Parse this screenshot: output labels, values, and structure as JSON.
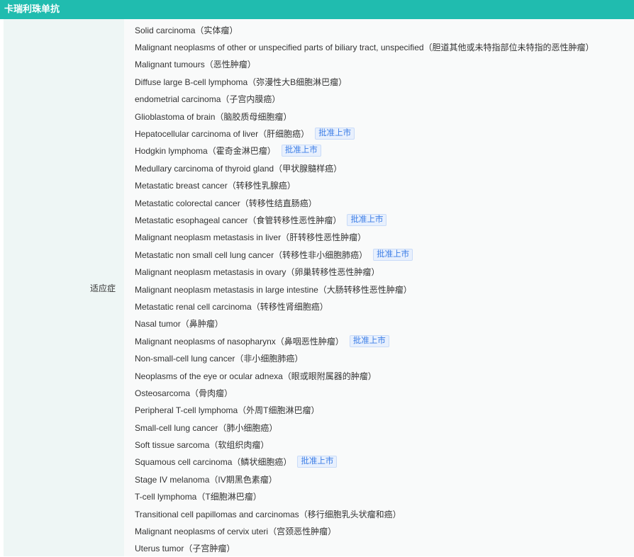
{
  "header": {
    "title": "卡瑞利珠单抗"
  },
  "row": {
    "label": "适应症"
  },
  "badge_label": "批准上市",
  "items": [
    {
      "text": "Solid carcinoma（实体瘤）",
      "approved": false
    },
    {
      "text": "Malignant neoplasms of other or unspecified parts of biliary tract, unspecified（胆道其他或未特指部位未特指的恶性肿瘤）",
      "approved": false
    },
    {
      "text": "Malignant tumours（恶性肿瘤）",
      "approved": false
    },
    {
      "text": "Diffuse large B-cell lymphoma（弥漫性大B细胞淋巴瘤）",
      "approved": false
    },
    {
      "text": "endometrial carcinoma（子宫内膜癌）",
      "approved": false
    },
    {
      "text": "Glioblastoma of brain（脑胶质母细胞瘤）",
      "approved": false
    },
    {
      "text": "Hepatocellular carcinoma of liver（肝细胞癌）",
      "approved": true
    },
    {
      "text": "Hodgkin lymphoma（霍奇金淋巴瘤）",
      "approved": true
    },
    {
      "text": "Medullary carcinoma of thyroid gland（甲状腺髓样癌）",
      "approved": false
    },
    {
      "text": "Metastatic breast cancer（转移性乳腺癌）",
      "approved": false
    },
    {
      "text": "Metastatic colorectal cancer（转移性结直肠癌）",
      "approved": false
    },
    {
      "text": "Metastatic esophageal cancer（食管转移性恶性肿瘤）",
      "approved": true
    },
    {
      "text": "Malignant neoplasm metastasis in liver（肝转移性恶性肿瘤）",
      "approved": false
    },
    {
      "text": "Metastatic non small cell lung cancer（转移性非小细胞肺癌）",
      "approved": true
    },
    {
      "text": "Malignant neoplasm metastasis in ovary（卵巢转移性恶性肿瘤）",
      "approved": false
    },
    {
      "text": "Malignant neoplasm metastasis in large intestine（大肠转移性恶性肿瘤）",
      "approved": false
    },
    {
      "text": "Metastatic renal cell carcinoma（转移性肾细胞癌）",
      "approved": false
    },
    {
      "text": "Nasal tumor（鼻肿瘤）",
      "approved": false
    },
    {
      "text": "Malignant neoplasms of nasopharynx（鼻咽恶性肿瘤）",
      "approved": true
    },
    {
      "text": "Non-small-cell lung cancer（非小细胞肺癌）",
      "approved": false
    },
    {
      "text": "Neoplasms of the eye or ocular adnexa（眼或眼附属器的肿瘤）",
      "approved": false
    },
    {
      "text": "Osteosarcoma（骨肉瘤）",
      "approved": false
    },
    {
      "text": "Peripheral T-cell lymphoma（外周T细胞淋巴瘤）",
      "approved": false
    },
    {
      "text": "Small-cell lung cancer（肺小细胞癌）",
      "approved": false
    },
    {
      "text": "Soft tissue sarcoma（软组织肉瘤）",
      "approved": false
    },
    {
      "text": "Squamous cell carcinoma（鳞状细胞癌）",
      "approved": true
    },
    {
      "text": "Stage IV melanoma（IV期黑色素瘤）",
      "approved": false
    },
    {
      "text": "T-cell lymphoma（T细胞淋巴瘤）",
      "approved": false
    },
    {
      "text": "Transitional cell papillomas and carcinomas（移行细胞乳头状瘤和癌）",
      "approved": false
    },
    {
      "text": "Malignant neoplasms of cervix uteri（宫颈恶性肿瘤）",
      "approved": false
    },
    {
      "text": "Uterus tumor（子宫肿瘤）",
      "approved": false
    }
  ]
}
